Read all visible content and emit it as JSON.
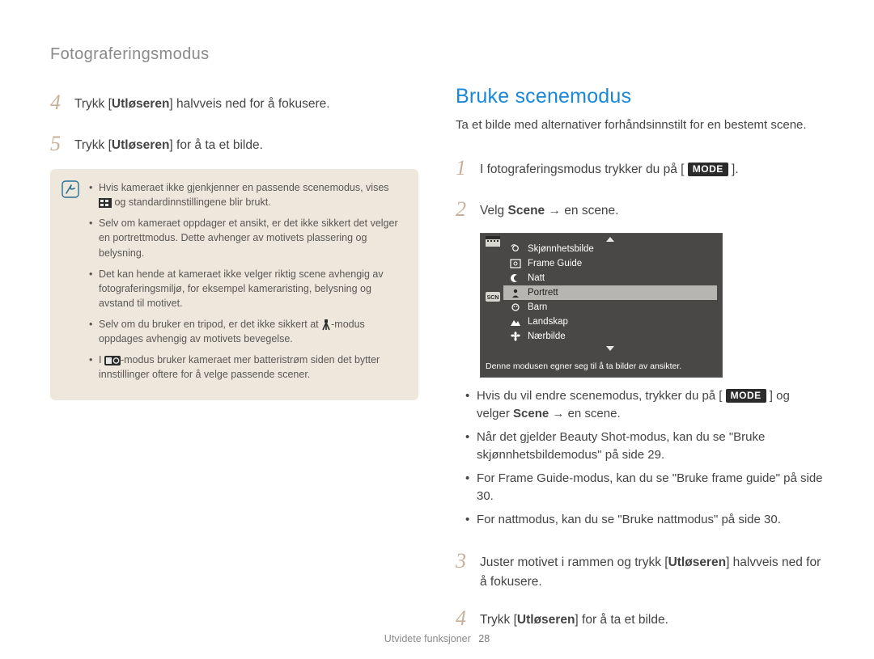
{
  "header": {
    "section_title": "Fotograferingsmodus"
  },
  "left": {
    "step4": {
      "num": "4",
      "pre": "Trykk [",
      "bold": "Utløseren",
      "post": "] halvveis ned for å fokusere."
    },
    "step5": {
      "num": "5",
      "pre": "Trykk [",
      "bold": "Utløseren",
      "post": "] for å ta et bilde."
    },
    "note_icon_alt": "info-icon",
    "note_items": {
      "i1a": "Hvis kameraet ikke gjenkjenner en passende scenemodus, vises",
      "i1b": " og standardinnstillingene blir brukt.",
      "i2": "Selv om kameraet oppdager et ansikt, er det ikke sikkert det velger en portrettmodus. Dette avhenger av motivets plassering og belysning.",
      "i3": "Det kan hende at kameraet ikke velger riktig scene avhengig av fotograferingsmiljø, for eksempel kameraristing, belysning og avstand til motivet.",
      "i4a": "Selv om du bruker en tripod, er det ikke sikkert at ",
      "i4b": "-modus oppdages avhengig av motivets bevegelse.",
      "i5a": "I ",
      "i5b": "-modus bruker kameraet mer batteristrøm siden det bytter innstillinger oftere for å velge passende scener."
    }
  },
  "right": {
    "title": "Bruke scenemodus",
    "intro": "Ta et bilde med alternativer forhåndsinnstilt for en bestemt scene.",
    "step1": {
      "num": "1",
      "pre": "I fotograferingsmodus trykker du på [ ",
      "mode": "MODE",
      "post": " ]."
    },
    "step2": {
      "num": "2",
      "a": "Velg ",
      "b": "Scene",
      "c": " → en scene."
    },
    "scene_items": [
      {
        "id": "beauty",
        "label": "Skjønnhetsbilde"
      },
      {
        "id": "frame",
        "label": "Frame Guide"
      },
      {
        "id": "night",
        "label": "Natt"
      },
      {
        "id": "portrait",
        "label": "Portrett",
        "selected": true
      },
      {
        "id": "child",
        "label": "Barn"
      },
      {
        "id": "land",
        "label": "Landskap"
      },
      {
        "id": "close",
        "label": "Nærbilde"
      }
    ],
    "scene_footer": "Denne modusen egner seg til å ta bilder av ansikter.",
    "bullets": {
      "b1a": "Hvis du vil endre scenemodus, trykker du på [ ",
      "b1mode": "MODE",
      "b1b": " ] og velger ",
      "b1c": "Scene",
      "b1d": " → en scene.",
      "b2": "Når det gjelder Beauty Shot-modus, kan du se \"Bruke skjønnhetsbildemodus\" på side 29.",
      "b3": "For Frame Guide-modus, kan du se \"Bruke frame guide\" på side 30.",
      "b4": "For nattmodus, kan du se \"Bruke nattmodus\" på side 30."
    },
    "step3": {
      "num": "3",
      "a": "Juster motivet i rammen og trykk [",
      "b": "Utløseren",
      "c": "] halvveis ned for å fokusere."
    },
    "step4b": {
      "num": "4",
      "a": "Trykk [",
      "b": "Utløseren",
      "c": "] for å ta et bilde."
    }
  },
  "footer": {
    "label": "Utvidete funksjoner",
    "page": "28"
  }
}
